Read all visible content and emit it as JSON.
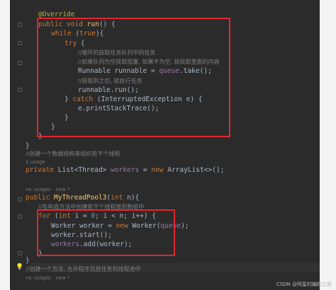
{
  "code": {
    "annotation": "@Override",
    "run_decl": {
      "kw": "public void",
      "name": "run",
      "tail": "() {"
    },
    "while_line": {
      "kw": "while",
      "cond_open": " (",
      "cond_true": "true",
      "cond_close": "){"
    },
    "try_line": {
      "kw": "try",
      "tail": " {"
    },
    "comment_loop": "//循环的获取任务队列中的任务",
    "comment_block": "//如果队列为空获取阻塞, 如果不为空, 就获取里面的内容",
    "runnable_line": {
      "type": "Runnable runnable = ",
      "field": "queue",
      "call": ".take();"
    },
    "comment_run": "//获取到之后, 就执行任务",
    "run_call": "runnable.run();",
    "catch_line": {
      "close": "} ",
      "kw": "catch",
      "rest": " (InterruptedException e) {"
    },
    "print_trace": "e.printStackTrace();",
    "brace_close": "}",
    "comment_workers": "//创建一个数据结构来组织若干个线程",
    "usage_1": "1 usage",
    "workers_decl": {
      "kw": "private",
      "type": " List<Thread> ",
      "field": "workers",
      "eq": " = ",
      "new_kw": "new",
      "rest": " ArrayList<>();"
    },
    "usage_none_1": "no usages   new *",
    "ctor_decl": {
      "kw": "public",
      "name": " MyThreadPool3",
      "open": "(",
      "ptype": "int",
      "rest": " n){"
    },
    "comment_ctor": "//在构造方法中创建若干个线程放到数组中",
    "for_line": {
      "kw": "for",
      "open": " (",
      "ikw": "int",
      "i1": " i",
      "eq": " = ",
      "zero": "0",
      "semi1": "; ",
      "i2": "i",
      "lt": " < n; ",
      "i3": "i",
      "inc": "++) {"
    },
    "worker_line": {
      "a": "Worker worker = ",
      "new_kw": "new",
      "b": " Worker(",
      "field": "queue",
      "c": ");"
    },
    "start_line": "worker.start();",
    "add_line": {
      "field": "workers",
      "rest": ".add(worker);"
    },
    "comment_submit": "//创建一个方法, 允许程序员放任务到线程池中",
    "usage_none_2": "no usages   new *"
  },
  "watermark": "CSDN @阿星的编程之旅"
}
